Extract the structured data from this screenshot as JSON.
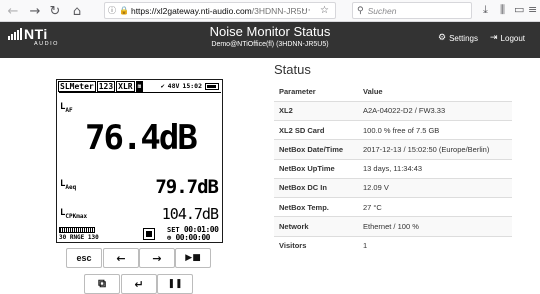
{
  "browser": {
    "url_host": "https://xl2gateway.nti-audio.com",
    "url_path": "/3HDNN-JR5U",
    "search_placeholder": "Suchen"
  },
  "header": {
    "logo_text": "NTi",
    "logo_sub": "AUDIO",
    "title": "Noise Monitor Status",
    "subtitle": "Demo@NTiOffice(fl) (3HDNN-JR5U5)",
    "settings_label": "Settings",
    "logout_label": "Logout"
  },
  "device": {
    "tabs": [
      "SLMeter",
      "123",
      "XLR"
    ],
    "phantom": "48V",
    "clock": "15:02",
    "label1": "L",
    "label1_sub": "AF",
    "value1": "76.4dB",
    "label2": "L",
    "label2_sub": "Aeq",
    "value2": "79.7dB",
    "label3": "L",
    "label3_sub": "CPKmax",
    "value3": "104.7dB",
    "range_text": "30  RNGE 130",
    "set_label": "SET",
    "time1": "00:01:00",
    "time2": "00:00:00"
  },
  "buttons": {
    "esc": "esc",
    "left": "←",
    "right": "→",
    "skip": "▶■",
    "copy": "⧉",
    "enter": "↵",
    "pause": "❚❚"
  },
  "status": {
    "heading": "Status",
    "col_param": "Parameter",
    "col_value": "Value",
    "rows": [
      {
        "k": "XL2",
        "v": "A2A-04022-D2 / FW3.33"
      },
      {
        "k": "XL2 SD Card",
        "v": "100.0 % free of 7.5 GB"
      },
      {
        "k": "NetBox Date/Time",
        "v": "2017-12-13 / 15:02:50 (Europe/Berlin)"
      },
      {
        "k": "NetBox UpTime",
        "v": "13 days, 11:34:43"
      },
      {
        "k": "NetBox DC In",
        "v": "12.09 V"
      },
      {
        "k": "NetBox Temp.",
        "v": "27 °C"
      },
      {
        "k": "Network",
        "v": "Ethernet / 100 %"
      },
      {
        "k": "Visitors",
        "v": "1"
      }
    ]
  }
}
